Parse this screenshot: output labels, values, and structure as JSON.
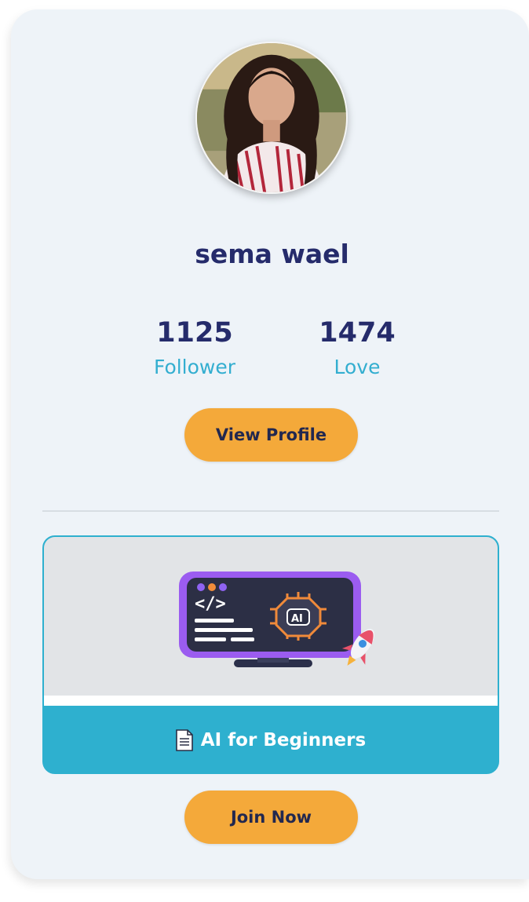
{
  "profile": {
    "name": "sema wael",
    "avatar_icon": "user-photo",
    "followers_count": "1125",
    "followers_label": "Follower",
    "loves_count": "1474",
    "loves_label": "Love",
    "view_profile_label": "View Profile"
  },
  "course": {
    "title": "AI for Beginners",
    "title_icon": "document-icon",
    "image_icon": "ai-monitor-rocket-illustration",
    "join_label": "Join Now"
  },
  "colors": {
    "card_bg": "#eef3f8",
    "name_text": "#252b6b",
    "stat_label": "#33aed0",
    "button_bg": "#f4a93a",
    "course_accent": "#2eb0cf"
  }
}
